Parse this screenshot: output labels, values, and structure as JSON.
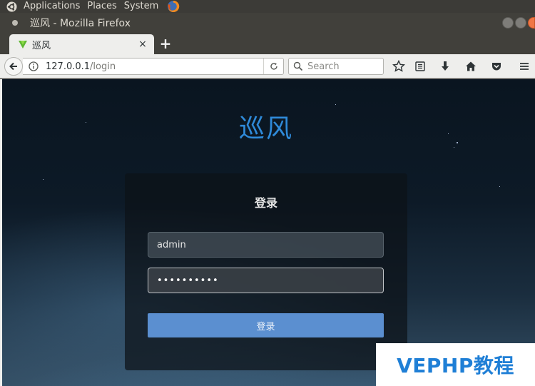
{
  "panel": {
    "menus": [
      "Applications",
      "Places",
      "System"
    ]
  },
  "window": {
    "title": "巡风 - Mozilla Firefox"
  },
  "tabs": [
    {
      "label": "巡风",
      "close": "×"
    }
  ],
  "new_tab_label": "+",
  "navbar": {
    "url_host": "127.0.0.1",
    "url_path": "/login",
    "search_placeholder": "Search"
  },
  "page": {
    "site_title": "巡风",
    "card_title": "登录",
    "username_value": "admin",
    "password_value": "••••••••••",
    "submit_label": "登录"
  },
  "watermark": "VEPHP教程",
  "icons": {
    "os_logo": "ubuntu-logo-icon",
    "firefox": "firefox-icon",
    "tab_favicon": "green-shield-favicon-icon",
    "back": "arrow-left-icon",
    "info": "info-circle-icon",
    "reload": "reload-icon",
    "search": "search-icon",
    "bookmark_star": "star-icon",
    "reading_list": "reader-list-icon",
    "downloads": "download-arrow-icon",
    "home": "home-icon",
    "pocket": "pocket-icon",
    "menu": "hamburger-menu-icon"
  },
  "colors": {
    "accent_title": "#2f8ad9",
    "submit_button": "#5b8fd0",
    "watermark_text": "#1f7fd6",
    "panel_bg": "#3c3b37"
  }
}
